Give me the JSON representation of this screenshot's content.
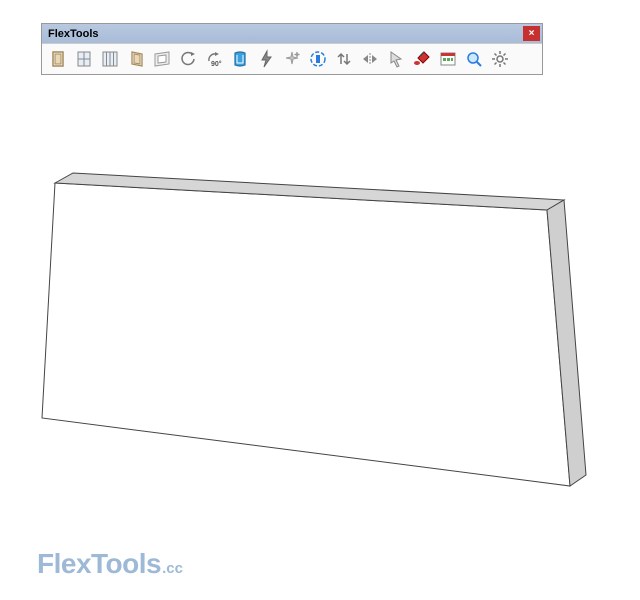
{
  "toolbar": {
    "title": "FlexTools",
    "close_symbol": "×",
    "icons": [
      {
        "name": "door-single-icon"
      },
      {
        "name": "window-single-icon"
      },
      {
        "name": "window-double-icon"
      },
      {
        "name": "door-angled-icon"
      },
      {
        "name": "wall-opening-icon"
      },
      {
        "name": "refresh-undo-icon"
      },
      {
        "name": "rotate-90-icon"
      },
      {
        "name": "wall-cutter-icon"
      },
      {
        "name": "lightning-icon"
      },
      {
        "name": "sparkle-icon"
      },
      {
        "name": "dynamic-component-icon"
      },
      {
        "name": "swap-vertical-icon"
      },
      {
        "name": "flip-horizontal-icon"
      },
      {
        "name": "select-arrow-icon"
      },
      {
        "name": "paint-bucket-red-icon"
      },
      {
        "name": "component-browser-icon"
      },
      {
        "name": "zoom-search-icon"
      },
      {
        "name": "settings-gear-icon"
      }
    ]
  },
  "logo": {
    "main": "FlexTools",
    "suffix": ".cc"
  },
  "scene": {
    "object": "rectangular-wall-slab"
  }
}
